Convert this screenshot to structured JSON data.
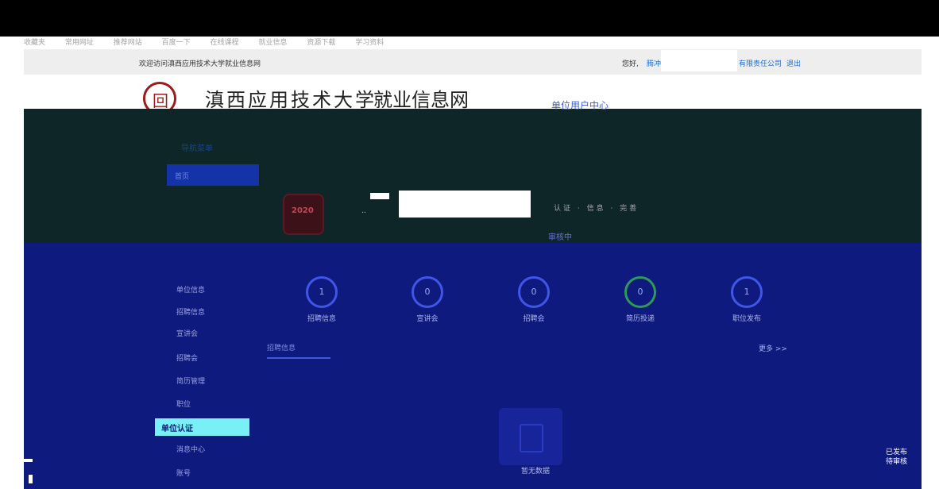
{
  "top_bar": {
    "welcome": "欢迎访问滇西应用技术大学就业信息网",
    "hello": "您好,",
    "user_partial": "腾冲",
    "company_tail": "有限责任公司",
    "logout": "退出"
  },
  "bookmarks": [
    "收藏夹",
    "常用网址",
    "推荐网站",
    "百度一下",
    "在线课程",
    "就业信息",
    "资源下载",
    "学习资料"
  ],
  "header": {
    "university": "滇西应用技术大学",
    "site_name": "就业信息网",
    "center_title": "单位用户中心"
  },
  "nav": {
    "label": "导航菜单",
    "home_button": "首页"
  },
  "company": {
    "meta": "认证 · 信息 · 完善",
    "status": "审核中"
  },
  "stats": [
    {
      "value": "1",
      "label": "招聘信息"
    },
    {
      "value": "0",
      "label": "宣讲会"
    },
    {
      "value": "0",
      "label": "招聘会"
    },
    {
      "value": "0",
      "label": "简历投递"
    },
    {
      "value": "1",
      "label": "职位发布"
    }
  ],
  "sidebar": [
    "单位信息",
    "招聘信息",
    "宣讲会",
    "招聘会",
    "简历管理",
    "职位",
    "单位认证",
    "消息中心",
    "账号"
  ],
  "tabs": {
    "active": "招聘信息",
    "more": "更多 >>"
  },
  "empty": {
    "text": "暂无数据"
  },
  "right_mark": [
    "已发布",
    "待审核"
  ]
}
